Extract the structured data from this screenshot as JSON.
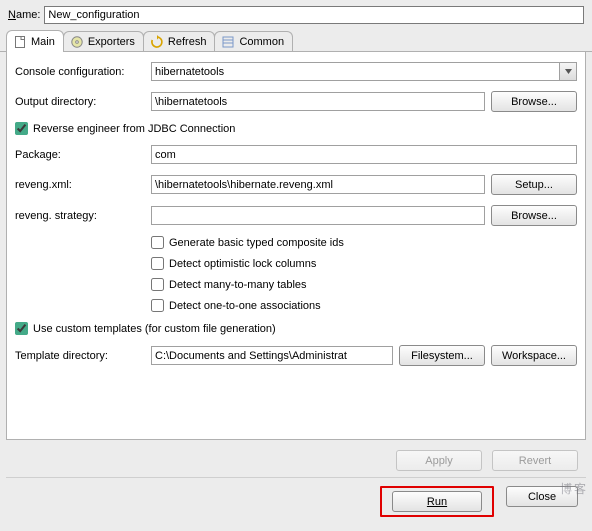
{
  "name_label_pre": "N",
  "name_label_post": "ame:",
  "name_value": "New_configuration",
  "tabs": {
    "main": "Main",
    "exporters": "Exporters",
    "refresh": "Refresh",
    "common": "Common"
  },
  "fields": {
    "console_config_label": "Console configuration:",
    "console_config_value": "hibernatetools",
    "output_dir_label": "Output directory:",
    "output_dir_value": "\\hibernatetools",
    "browse_btn": "Browse...",
    "reverse_engineer_label": "Reverse engineer from JDBC Connection",
    "package_label": "Package:",
    "package_value": "com",
    "reveng_xml_label": "reveng.xml:",
    "reveng_xml_value": "\\hibernatetools\\hibernate.reveng.xml",
    "setup_btn": "Setup...",
    "reveng_strategy_label": "reveng. strategy:",
    "reveng_strategy_value": "",
    "checks": {
      "composite_ids": "Generate basic typed composite ids",
      "optimistic_lock": "Detect optimistic lock columns",
      "many_to_many": "Detect many-to-many tables",
      "one_to_one": "Detect one-to-one associations"
    },
    "use_custom_templates": "Use custom templates (for custom file generation)",
    "template_dir_label": "Template directory:",
    "template_dir_value": "C:\\Documents and Settings\\Administrat",
    "filesystem_btn": "Filesystem...",
    "workspace_btn": "Workspace..."
  },
  "buttons": {
    "apply": "Apply",
    "revert": "Revert",
    "run": "Run",
    "close": "Close"
  },
  "watermark": "博客"
}
